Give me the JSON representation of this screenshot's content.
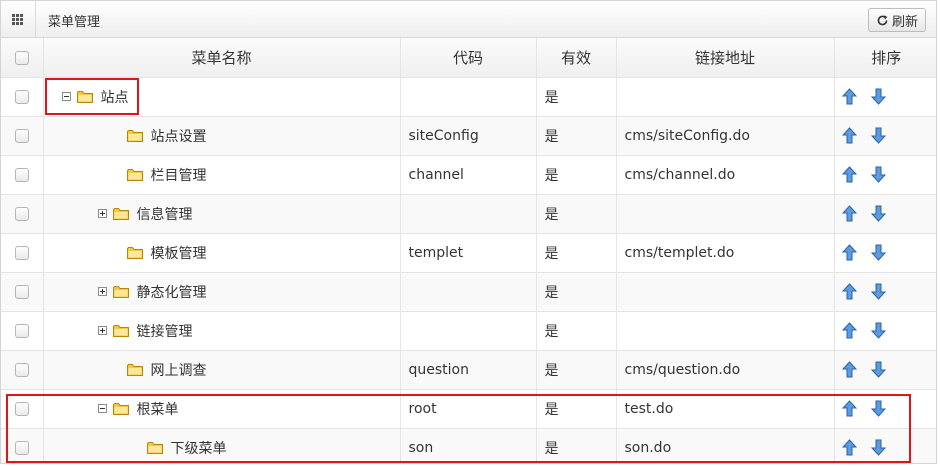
{
  "panel": {
    "title": "菜单管理",
    "refresh_label": "刷新"
  },
  "columns": [
    "菜单名称",
    "代码",
    "有效",
    "链接地址",
    "排序"
  ],
  "rows": [
    {
      "name": "站点",
      "code": "",
      "valid": "是",
      "link": "",
      "indent": 0,
      "toggle": "minus"
    },
    {
      "name": "站点设置",
      "code": "siteConfig",
      "valid": "是",
      "link": "cms/siteConfig.do",
      "indent": 2,
      "toggle": "none"
    },
    {
      "name": "栏目管理",
      "code": "channel",
      "valid": "是",
      "link": "cms/channel.do",
      "indent": 2,
      "toggle": "none"
    },
    {
      "name": "信息管理",
      "code": "",
      "valid": "是",
      "link": "",
      "indent": 1,
      "toggle": "plus"
    },
    {
      "name": "模板管理",
      "code": "templet",
      "valid": "是",
      "link": "cms/templet.do",
      "indent": 2,
      "toggle": "none"
    },
    {
      "name": "静态化管理",
      "code": "",
      "valid": "是",
      "link": "",
      "indent": 1,
      "toggle": "plus"
    },
    {
      "name": "链接管理",
      "code": "",
      "valid": "是",
      "link": "",
      "indent": 1,
      "toggle": "plus"
    },
    {
      "name": "网上调查",
      "code": "question",
      "valid": "是",
      "link": "cms/question.do",
      "indent": 2,
      "toggle": "none"
    },
    {
      "name": "根菜单",
      "code": "root",
      "valid": "是",
      "link": "test.do",
      "indent": 1,
      "toggle": "minus"
    },
    {
      "name": "下级菜单",
      "code": "son",
      "valid": "是",
      "link": "son.do",
      "indent": 3,
      "toggle": "none"
    }
  ],
  "colors": {
    "highlight": "#e0141b",
    "arrow": "#3b7fd1",
    "folder": "#f5c93c"
  }
}
